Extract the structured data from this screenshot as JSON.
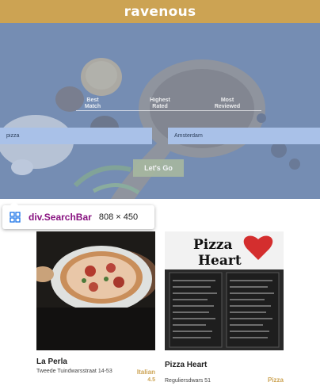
{
  "header": {
    "brand": "ravenous"
  },
  "search": {
    "sort_options": [
      {
        "label": "Best Match"
      },
      {
        "label": "Highest Rated"
      },
      {
        "label": "Most Reviewed"
      }
    ],
    "term_value": "pizza",
    "location_value": "Amsterdam",
    "submit_label": "Let's Go"
  },
  "devtools_tooltip": {
    "selector": "div.SearchBar",
    "size": "808 × 450"
  },
  "businesses": [
    {
      "name": "La Perla",
      "address": "Tweede Tuindwarsstraat 14-53",
      "category": "Italian",
      "rating": "4.5"
    },
    {
      "name": "Pizza Heart",
      "address": "Reguliersdwars 51",
      "category": "Pizza"
    }
  ],
  "colors": {
    "brand": "#cca353",
    "input_bg": "#a9c1e8",
    "tooltip_selector": "#881280"
  }
}
